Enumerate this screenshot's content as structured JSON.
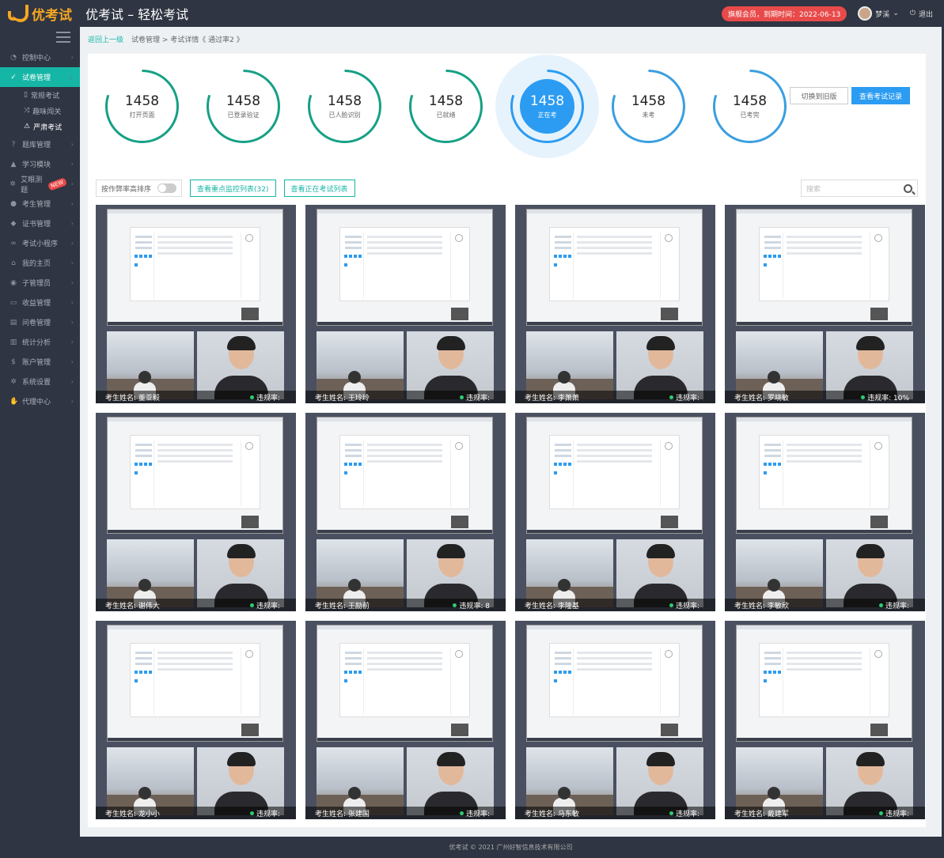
{
  "app": {
    "brand": "优考试",
    "title": "优考试 – 轻松考试"
  },
  "header": {
    "vip_badge": "旗舰会员，到期时间：2022-06-13",
    "username": "梦溪",
    "logout": "退出"
  },
  "sidebar": {
    "items": [
      {
        "label": "控制中心",
        "icon": "dashboard-icon"
      },
      {
        "label": "试卷管理",
        "icon": "check-circle-icon",
        "active": true
      },
      {
        "label": "题库管理",
        "icon": "question-icon"
      },
      {
        "label": "学习模块",
        "icon": "graduation-icon"
      },
      {
        "label": "艾眼测题",
        "icon": "gear-icon",
        "badge": "NEW"
      },
      {
        "label": "考生管理",
        "icon": "user-icon"
      },
      {
        "label": "证书管理",
        "icon": "certificate-icon"
      },
      {
        "label": "考试小程序",
        "icon": "mini-program-icon"
      },
      {
        "label": "我的主页",
        "icon": "home-icon"
      },
      {
        "label": "子管理员",
        "icon": "admin-icon"
      },
      {
        "label": "收益管理",
        "icon": "wallet-icon"
      },
      {
        "label": "问卷管理",
        "icon": "survey-icon"
      },
      {
        "label": "统计分析",
        "icon": "chart-icon"
      },
      {
        "label": "账户管理",
        "icon": "dollar-icon"
      },
      {
        "label": "系统设置",
        "icon": "settings-icon"
      },
      {
        "label": "代理中心",
        "icon": "thumb-icon"
      }
    ],
    "subitems": [
      {
        "label": "常规考试",
        "icon": "doc-icon"
      },
      {
        "label": "趣味闯关",
        "icon": "shuffle-icon"
      },
      {
        "label": "严肃考试",
        "icon": "warning-icon",
        "current": true
      }
    ]
  },
  "breadcrumb": {
    "back": "返回上一级",
    "path": "试卷管理 > 考试详情《 通过率2 》"
  },
  "stats": [
    {
      "value": "1458",
      "label": "打开页面",
      "color": "#16a085",
      "fraction": 0.8
    },
    {
      "value": "1458",
      "label": "已登录验证",
      "color": "#16a085",
      "fraction": 0.8
    },
    {
      "value": "1458",
      "label": "已人脸识别",
      "color": "#16a085",
      "fraction": 0.8
    },
    {
      "value": "1458",
      "label": "已就绪",
      "color": "#16a085",
      "fraction": 0.8
    },
    {
      "value": "1458",
      "label": "正在考",
      "color": "#2b9cf2",
      "fraction": 0.8,
      "active": true
    },
    {
      "value": "1458",
      "label": "未考",
      "color": "#3a9fe0",
      "fraction": 0.8
    },
    {
      "value": "1458",
      "label": "已考完",
      "color": "#3a9fe0",
      "fraction": 0.8
    }
  ],
  "buttons": {
    "switch_old": "切换到旧版",
    "view_records": "查看考试记录"
  },
  "toolbar": {
    "sort_label": "按作弊率高排序",
    "focus_list": "查看重点监控列表(32)",
    "active_list": "查看正在考试列表",
    "search_placeholder": "搜索"
  },
  "candidates": [
    {
      "name": "考生姓名: 董亚毅",
      "rate": "违规率:"
    },
    {
      "name": "考生姓名: 王玲玲",
      "rate": "违规率:"
    },
    {
      "name": "考生姓名: 李萧萧",
      "rate": "违规率:"
    },
    {
      "name": "考生姓名: 罗晓敏",
      "rate": "违规率: 10%"
    },
    {
      "name": "考生姓名: 谢伟大",
      "rate": "违规率:"
    },
    {
      "name": "考生姓名: 王励前",
      "rate": "违规率: 8"
    },
    {
      "name": "考生姓名: 李隆基",
      "rate": "违规率:"
    },
    {
      "name": "考生姓名: 李敏欣",
      "rate": "违规率:"
    },
    {
      "name": "考生姓名: 龙小小",
      "rate": "违规率:"
    },
    {
      "name": "考生姓名: 张建国",
      "rate": "违规率:"
    },
    {
      "name": "考生姓名: 马东敏",
      "rate": "违规率:"
    },
    {
      "name": "考生姓名: 戴建军",
      "rate": "违规率:"
    }
  ],
  "footer": "优考试 © 2021 广州好智信息技术有限公司"
}
